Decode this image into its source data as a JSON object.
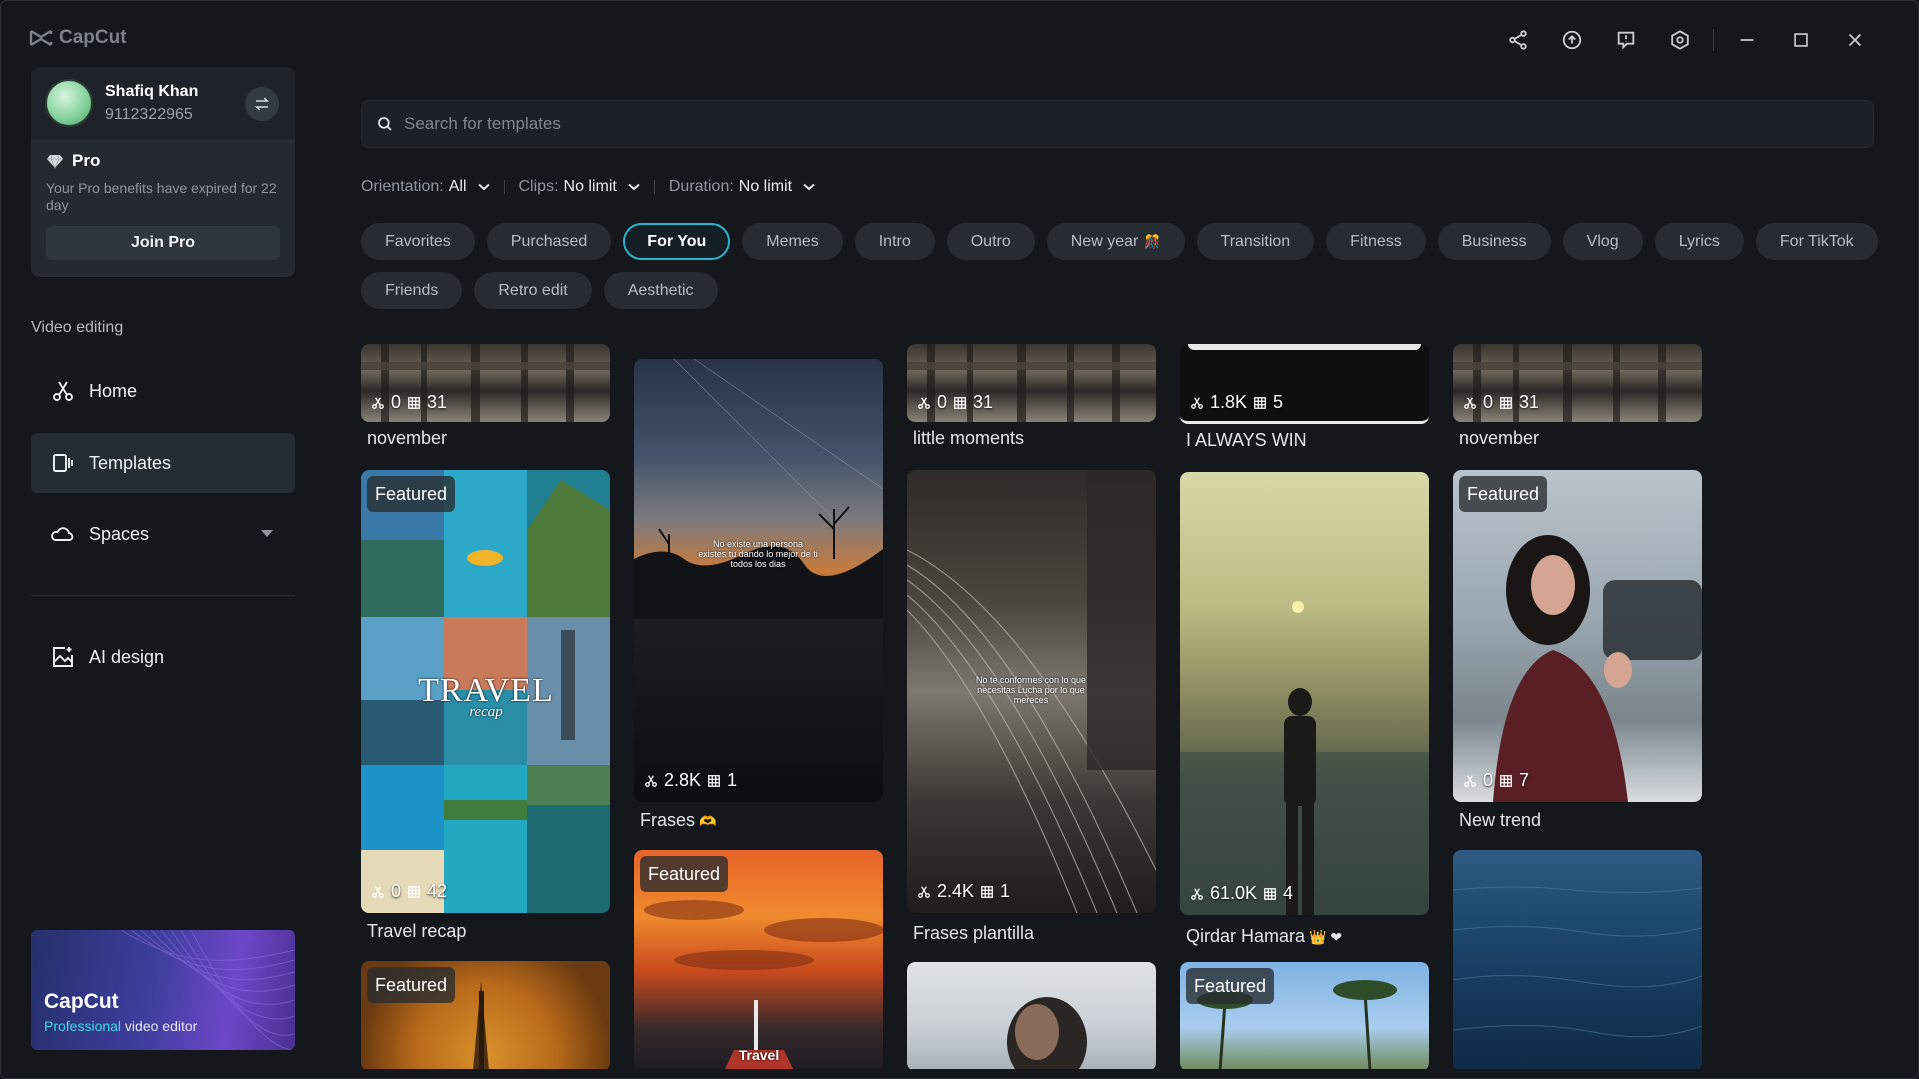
{
  "app": {
    "name": "CapCut"
  },
  "window_controls": {
    "icons": [
      "share-icon",
      "upload-icon",
      "feedback-icon",
      "settings-icon",
      "minimize-icon",
      "maximize-icon",
      "close-icon"
    ]
  },
  "profile": {
    "name": "Shafiq Khan",
    "phone": "9112322965",
    "pro_label": "Pro",
    "pro_desc": "Your Pro benefits have expired for 22 day",
    "join_label": "Join Pro"
  },
  "sidebar": {
    "section_label": "Video editing",
    "items": [
      {
        "label": "Home",
        "icon": "scissors-icon"
      },
      {
        "label": "Templates",
        "icon": "templates-icon"
      },
      {
        "label": "Spaces",
        "icon": "cloud-icon"
      },
      {
        "label": "AI design",
        "icon": "ai-design-icon"
      }
    ]
  },
  "promo": {
    "title": "CapCut",
    "sub_highlight": "Professional",
    "sub_rest": " video editor"
  },
  "search": {
    "placeholder": "Search for templates"
  },
  "filters": [
    {
      "key": "Orientation:",
      "value": "All"
    },
    {
      "key": "Clips:",
      "value": "No limit"
    },
    {
      "key": "Duration:",
      "value": "No limit"
    }
  ],
  "categories": [
    "Favorites",
    "Purchased",
    "For You",
    "Memes",
    "Intro",
    "Outro",
    "New year",
    "Transition",
    "Fitness",
    "Business",
    "Vlog",
    "Lyrics",
    "For TikTok",
    "Friends",
    "Retro edit",
    "Aesthetic"
  ],
  "active_category": "For You",
  "new_year_emoji": "🎊",
  "cards": [
    {
      "title": "november",
      "uses": "0",
      "clips": "31"
    },
    {
      "title": "Frases",
      "title_emoji": "🫶",
      "uses": "2.8K",
      "clips": "1",
      "overlay": "No existe una persona existes tu dando lo mejor de ti todos los dias"
    },
    {
      "title": "little moments",
      "uses": "0",
      "clips": "31"
    },
    {
      "title": "I ALWAYS WIN",
      "uses": "1.8K",
      "clips": "5"
    },
    {
      "title": "november",
      "uses": "0",
      "clips": "31"
    },
    {
      "title": "Travel recap",
      "badge": "Featured",
      "uses": "0",
      "clips": "42",
      "overlay": "TRAVEL",
      "overlay_sub": "recap"
    },
    {
      "title": "Frases plantilla",
      "uses": "2.4K",
      "clips": "1",
      "overlay": "No te conformes con lo que necesitas Lucha por lo que mereces"
    },
    {
      "title": "Qirdar Hamara",
      "title_emoji": "👑 ❤",
      "uses": "61.0K",
      "clips": "4"
    },
    {
      "title": "New trend",
      "badge": "Featured",
      "uses": "0",
      "clips": "7"
    },
    {
      "badge": "Featured",
      "overlay": "Travel"
    },
    {
      "badge": "Featured"
    },
    {
      "badge": "Featured"
    }
  ],
  "colors": {
    "accent": "#2fb3c8",
    "background": "#14181d",
    "chip": "#262c32"
  }
}
